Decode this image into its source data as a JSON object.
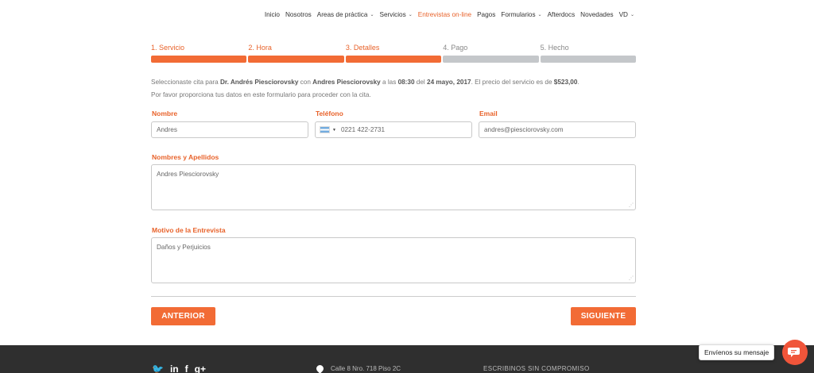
{
  "nav": {
    "items": [
      {
        "label": "Inicio",
        "caret": false,
        "active": false
      },
      {
        "label": "Nosotros",
        "caret": false,
        "active": false
      },
      {
        "label": "Areas de práctica",
        "caret": true,
        "active": false
      },
      {
        "label": "Servicios",
        "caret": true,
        "active": false
      },
      {
        "label": "Entrevistas on-line",
        "caret": false,
        "active": true
      },
      {
        "label": "Pagos",
        "caret": false,
        "active": false
      },
      {
        "label": "Formularios",
        "caret": true,
        "active": false
      },
      {
        "label": "Afterdocs",
        "caret": false,
        "active": false
      },
      {
        "label": "Novedades",
        "caret": false,
        "active": false
      },
      {
        "label": "VD",
        "caret": true,
        "active": false
      }
    ]
  },
  "steps": [
    {
      "label": "1. Servicio",
      "done": true
    },
    {
      "label": "2. Hora",
      "done": true
    },
    {
      "label": "3. Detalles",
      "done": true
    },
    {
      "label": "4. Pago",
      "done": false
    },
    {
      "label": "5. Hecho",
      "done": false
    }
  ],
  "info": {
    "p1": "Seleccionaste cita para ",
    "doctor": "Dr. Andrés Piesciorovsky",
    "p2": " con ",
    "client": "Andres Piesciorovsky",
    "p3": " a las ",
    "time": "08:30",
    "p4": " del ",
    "date": "24 mayo, 2017",
    "p5": ". El precio del servicio es de ",
    "price": "$523,00",
    "p6": ".",
    "line2": "Por favor proporciona tus datos en este formulario para proceder con la cita."
  },
  "form": {
    "nombre_label": "Nombre",
    "nombre_value": "Andres",
    "telefono_label": "Teléfono",
    "telefono_value": "0221 422-2731",
    "email_label": "Email",
    "email_value": "andres@piesciorovsky.com",
    "apellidos_label": "Nombres y Apellidos",
    "apellidos_value": "Andres Piesciorovsky",
    "motivo_label": "Motivo de la Entrevista",
    "motivo_value": "Daños y Perjuicios"
  },
  "buttons": {
    "back": "ANTERIOR",
    "next": "SIGUIENTE"
  },
  "footer": {
    "social": [
      "twitter-icon",
      "linkedin-icon",
      "facebook-icon",
      "google-plus-icon"
    ],
    "social_glyphs": [
      "🐦",
      "in",
      "f",
      "g+"
    ],
    "address": "Calle 8 Nro. 718 Piso 2C",
    "escribinos": "ESCRIBINOS SIN COMPROMISO"
  },
  "chat": {
    "label": "Envíenos su mensaje",
    "color": "#f0553a"
  },
  "colors": {
    "accent": "#f26b35",
    "step_todo": "#c4c7ca",
    "footer_bg": "#2f2f2f"
  }
}
